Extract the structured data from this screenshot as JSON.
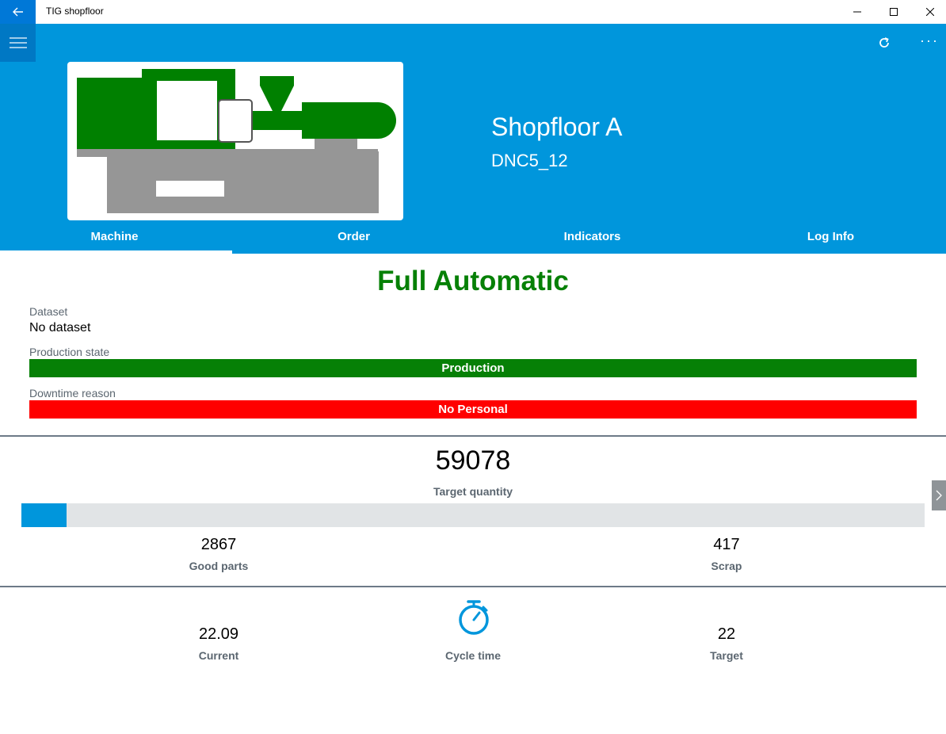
{
  "window": {
    "title": "TIG shopfloor"
  },
  "header": {
    "shopfloor_name": "Shopfloor A",
    "machine_id": "DNC5_12",
    "more_label": "···"
  },
  "tabs": [
    {
      "label": "Machine",
      "selected": true
    },
    {
      "label": "Order",
      "selected": false
    },
    {
      "label": "Indicators",
      "selected": false
    },
    {
      "label": "Log Info",
      "selected": false
    }
  ],
  "machine": {
    "mode": "Full Automatic",
    "dataset_label": "Dataset",
    "dataset_value": "No dataset",
    "production_state_label": "Production state",
    "production_state_value": "Production",
    "production_state_color": "#068006",
    "downtime_reason_label": "Downtime reason",
    "downtime_reason_value": "No Personal",
    "downtime_reason_color": "#ff0000"
  },
  "quantities": {
    "target_quantity": "59078",
    "target_quantity_label": "Target quantity",
    "progress_fraction": 0.05,
    "good_parts": "2867",
    "good_parts_label": "Good parts",
    "scrap": "417",
    "scrap_label": "Scrap"
  },
  "cycle_time": {
    "current": "22.09",
    "current_label": "Current",
    "label": "Cycle time",
    "target": "22",
    "target_label": "Target"
  },
  "colors": {
    "accent": "#0096dc",
    "accent_dark": "#0078d7",
    "mode_green": "#068006",
    "machine_green": "#008000",
    "machine_gray": "#969696"
  },
  "icons": {
    "back": "back-arrow-icon",
    "menu": "hamburger-menu-icon",
    "refresh": "refresh-icon",
    "more": "more-icon",
    "next": "chevron-right-icon",
    "cycle_time": "stopwatch-icon"
  }
}
